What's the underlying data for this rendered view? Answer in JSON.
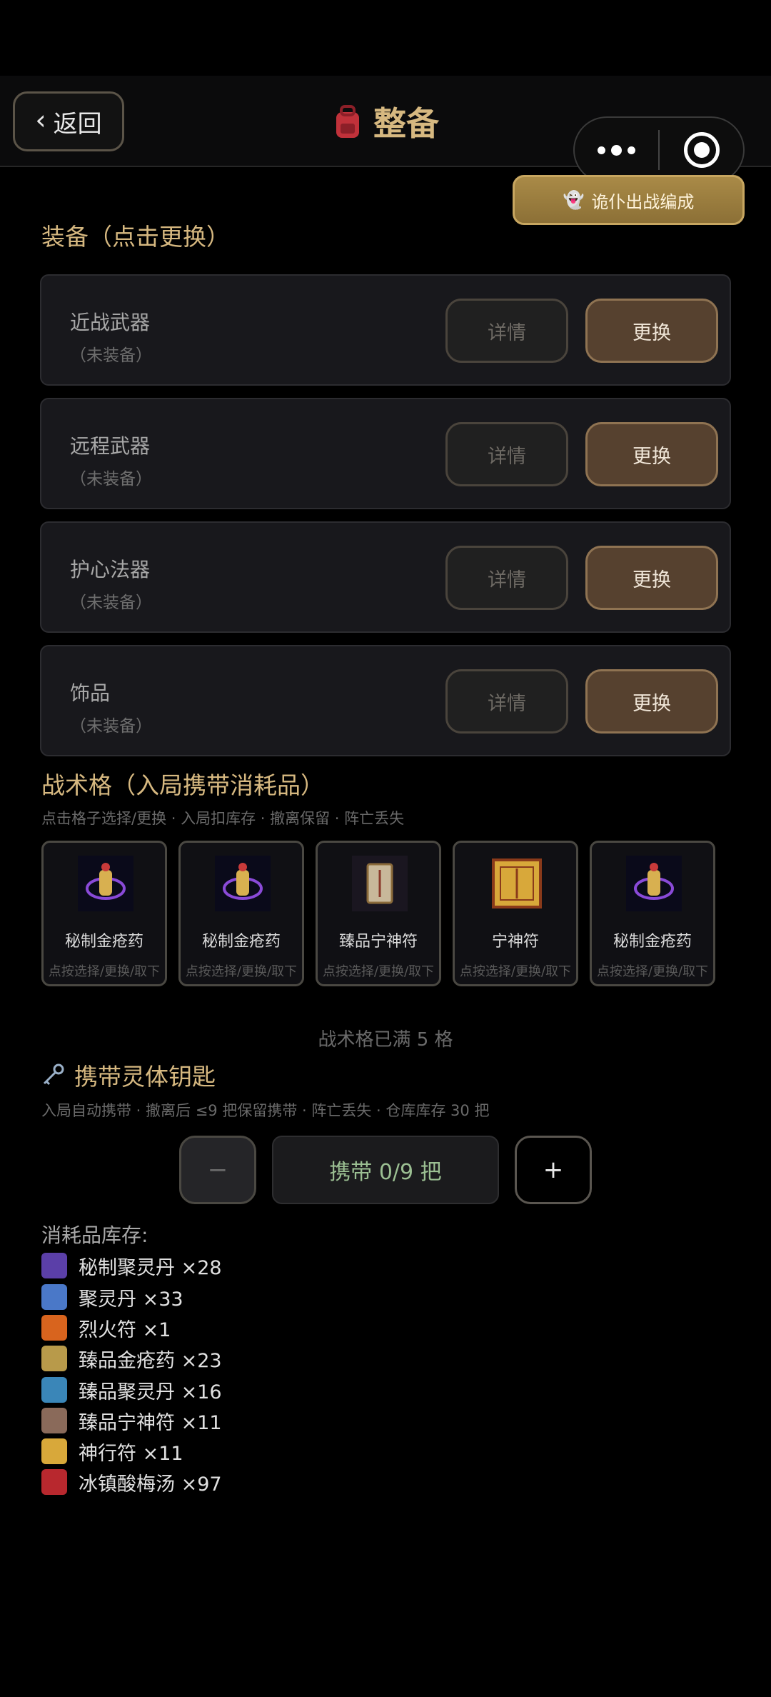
{
  "nav": {
    "back_label": "返回",
    "title": "整备",
    "formation_label": "诡仆出战编成"
  },
  "equipment": {
    "section_title": "装备（点击更换）",
    "items": [
      {
        "name": "近战武器",
        "status": "（未装备）",
        "detail_label": "详情",
        "swap_label": "更换"
      },
      {
        "name": "远程武器",
        "status": "（未装备）",
        "detail_label": "详情",
        "swap_label": "更换"
      },
      {
        "name": "护心法器",
        "status": "（未装备）",
        "detail_label": "详情",
        "swap_label": "更换"
      },
      {
        "name": "饰品",
        "status": "（未装备）",
        "detail_label": "详情",
        "swap_label": "更换"
      }
    ]
  },
  "tactics": {
    "section_title": "战术格（入局携带消耗品）",
    "hint": "点击格子选择/更换 · 入局扣库存 · 撤离保留 · 阵亡丢失",
    "slots": [
      {
        "name": "秘制金疮药",
        "hint": "点按选择/更换/取下",
        "icon": "potion-icon"
      },
      {
        "name": "秘制金疮药",
        "hint": "点按选择/更换/取下",
        "icon": "potion-icon"
      },
      {
        "name": "臻品宁神符",
        "hint": "点按选择/更换/取下",
        "icon": "talisman-icon"
      },
      {
        "name": "宁神符",
        "hint": "点按选择/更换/取下",
        "icon": "talisman-icon"
      },
      {
        "name": "秘制金疮药",
        "hint": "点按选择/更换/取下",
        "icon": "potion-icon"
      }
    ],
    "full_text": "战术格已满 5 格"
  },
  "key": {
    "title": "携带灵体钥匙",
    "hint": "入局自动携带 · 撤离后 ≤9 把保留携带 · 阵亡丢失 · 仓库库存 30 把",
    "minus_label": "−",
    "plus_label": "+",
    "carry_text": "携带 0/9 把"
  },
  "inventory": {
    "title": "消耗品库存:",
    "items": [
      {
        "label": "秘制聚灵丹 ×28",
        "icon": "purple-orb-icon",
        "color": "#5b3fa8"
      },
      {
        "label": "聚灵丹 ×33",
        "icon": "blue-flask-icon",
        "color": "#4a78c8"
      },
      {
        "label": "烈火符 ×1",
        "icon": "fire-icon",
        "color": "#d8641e"
      },
      {
        "label": "臻品金疮药 ×23",
        "icon": "gold-flask-icon",
        "color": "#b89a4a"
      },
      {
        "label": "臻品聚灵丹 ×16",
        "icon": "blue-orb-icon",
        "color": "#3a86b8"
      },
      {
        "label": "臻品宁神符 ×11",
        "icon": "scroll-icon",
        "color": "#8a6a5a"
      },
      {
        "label": "神行符 ×11",
        "icon": "talisman-icon",
        "color": "#d8a83a"
      },
      {
        "label": "冰镇酸梅汤 ×97",
        "icon": "drink-icon",
        "color": "#b8282e"
      }
    ]
  }
}
